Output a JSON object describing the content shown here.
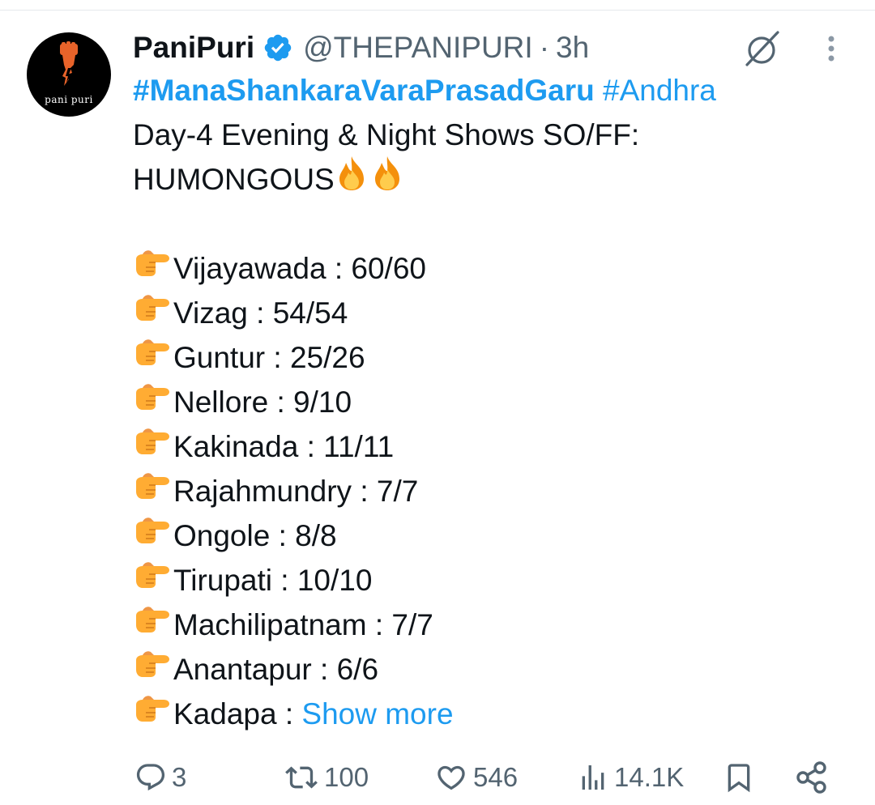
{
  "author": {
    "display_name": "PaniPuri",
    "handle": "@THEPANIPURI",
    "separator": "·",
    "time": "3h",
    "avatar_text": "pani puri",
    "avatar_icon": "raised-fist-logo",
    "verified_icon": "verified-badge-icon",
    "verified_color": "#1d9bf0"
  },
  "tweet": {
    "hashtag_1": "#ManaShankaraVaraPrasadGaru",
    "hashtag_2": "#Andhra",
    "line_1": "Day-4 Evening & Night Shows SO/FF:",
    "line_2": "HUMONGOUS",
    "fire_emoji": "🔥",
    "pointer_emoji": "👉",
    "cities": [
      "Vijayawada : 60/60",
      "Vizag : 54/54",
      "Guntur : 25/26",
      "Nellore : 9/10",
      "Kakinada : 11/11",
      "Rajahmundry : 7/7",
      "Ongole : 8/8",
      "Tirupati : 10/10",
      "Machilipatnam : 7/7",
      "Anantapur : 6/6"
    ],
    "truncated_line": "Kadapa : ",
    "show_more": "Show more"
  },
  "actions": {
    "reply_count": "3",
    "retweet_count": "100",
    "like_count": "546",
    "views_count": "14.1K"
  },
  "colors": {
    "accent": "#1d9bf0",
    "text": "#0f1419",
    "muted": "#536471"
  }
}
